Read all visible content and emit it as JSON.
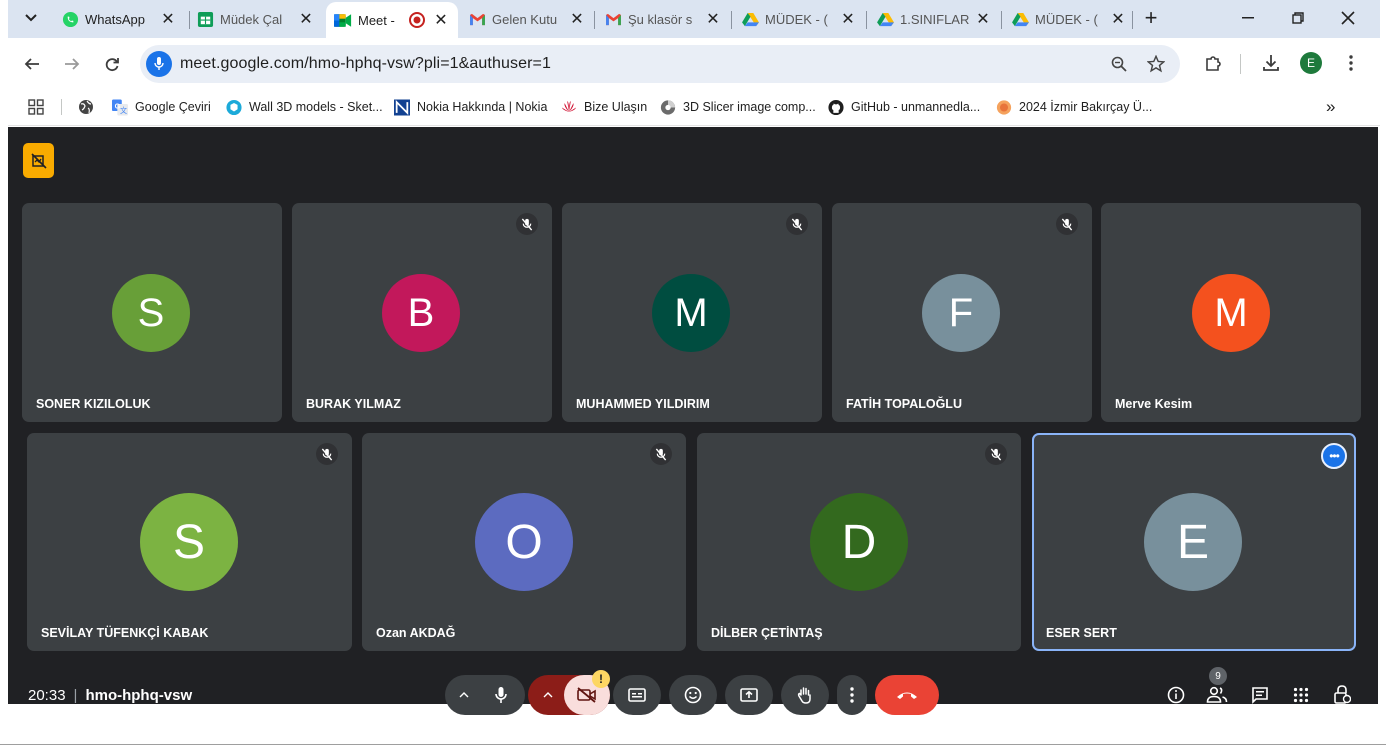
{
  "browser": {
    "tabs": [
      {
        "title": "WhatsApp",
        "icon": "whatsapp-icon"
      },
      {
        "title": "Müdek Çal",
        "icon": "sheets-icon"
      },
      {
        "title": "Meet -",
        "icon": "meet-icon",
        "active": true
      },
      {
        "title": "Gelen Kutu",
        "icon": "gmail-icon"
      },
      {
        "title": "Şu klasör s",
        "icon": "gmail-icon"
      },
      {
        "title": "MÜDEK - (",
        "icon": "drive-icon"
      },
      {
        "title": "1.SINIFLAR",
        "icon": "drive-icon"
      },
      {
        "title": "MÜDEK - (",
        "icon": "drive-icon"
      }
    ],
    "new_tab_label": "+",
    "url": "meet.google.com/hmo-hphq-vsw?pli=1&authuser=1",
    "profile_initial": "E",
    "bookmarks": [
      {
        "label": "",
        "icon": "globe-icon"
      },
      {
        "label": "Google Çeviri",
        "icon": "translate-icon"
      },
      {
        "label": "Wall 3D models - Sket...",
        "icon": "sketchfab-icon"
      },
      {
        "label": "Nokia Hakkında | Nokia",
        "icon": "nokia-icon"
      },
      {
        "label": "Bize Ulaşın",
        "icon": "huawei-icon"
      },
      {
        "label": "3D Slicer image comp...",
        "icon": "slicer-icon"
      },
      {
        "label": "GitHub - unmannedla...",
        "icon": "github-icon"
      },
      {
        "label": "2024 İzmir Bakırçay Ü...",
        "icon": "bakircay-icon"
      }
    ],
    "bookmarks_more": "»"
  },
  "meet": {
    "time": "20:33",
    "divider": "|",
    "meeting_code": "hmo-hphq-vsw",
    "participant_count": "9",
    "warning": "!",
    "participants": [
      {
        "name": "SONER KIZILOLUK",
        "initial": "S",
        "color": "#689f38",
        "muted": false
      },
      {
        "name": "BURAK YILMAZ",
        "initial": "B",
        "color": "#c2185b",
        "muted": true
      },
      {
        "name": "MUHAMMED YILDIRIM",
        "initial": "M",
        "color": "#004d40",
        "muted": true
      },
      {
        "name": "FATİH TOPALOĞLU",
        "initial": "F",
        "color": "#78909c",
        "muted": true
      },
      {
        "name": "Merve Kesim",
        "initial": "M",
        "color": "#f4511e",
        "muted": false
      },
      {
        "name": "SEVİLAY TÜFENKÇİ KABAK",
        "initial": "S",
        "color": "#7cb342",
        "muted": true
      },
      {
        "name": "Ozan AKDAĞ",
        "initial": "O",
        "color": "#5c6bc0",
        "muted": true
      },
      {
        "name": "DİLBER ÇETİNTAŞ",
        "initial": "D",
        "color": "#33691e",
        "muted": true
      },
      {
        "name": "ESER SERT",
        "initial": "E",
        "color": "#78909c",
        "muted": false,
        "self": true
      }
    ]
  }
}
